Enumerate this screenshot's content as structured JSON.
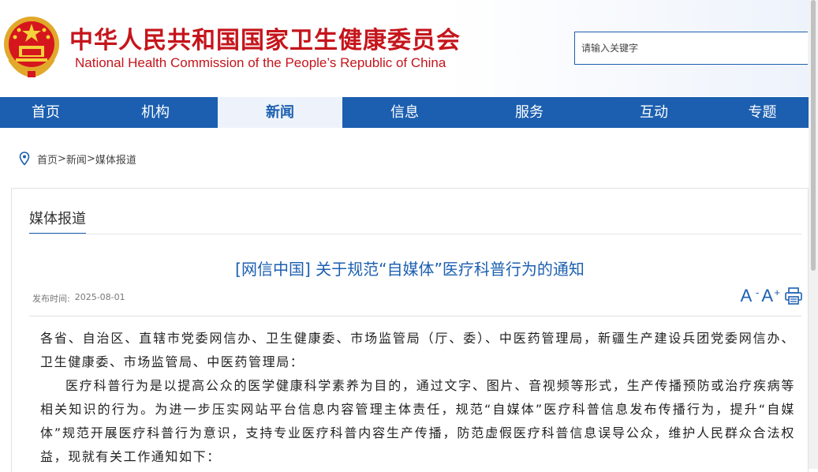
{
  "header": {
    "title_cn": "中华人民共和国国家卫生健康委员会",
    "title_en": "National Health Commission of the People’s  Republic of China",
    "emblem_icon": "national-emblem-icon",
    "brand_color": "#c5151c"
  },
  "search": {
    "placeholder": "请输入关键字"
  },
  "nav": {
    "accent": "#1c5fb0",
    "items": [
      {
        "label": "首页"
      },
      {
        "label": "机构"
      },
      {
        "label": "新闻",
        "active": true
      },
      {
        "label": "信息"
      },
      {
        "label": "服务"
      },
      {
        "label": "互动"
      },
      {
        "label": "专题"
      }
    ]
  },
  "breadcrumb": {
    "icon": "location-pin-icon",
    "items": [
      "首页",
      "新闻",
      "媒体报道"
    ],
    "separator": ">"
  },
  "section": {
    "title": "媒体报道"
  },
  "article": {
    "title": "[网信中国] 关于规范“自媒体”医疗科普行为的通知",
    "date_label": "发布时间:",
    "date": "2025-08-01",
    "font_decrease_label": "A",
    "font_increase_label": "A",
    "print_icon": "print-icon",
    "paragraphs": [
      "各省、自治区、直辖市党委网信办、卫生健康委、市场监管局（厅、委）、中医药管理局，新疆生产建设兵团党委网信办、卫生健康委、市场监管局、中医药管理局：",
      "医疗科普行为是以提高公众的医学健康科学素养为目的，通过文字、图片、音视频等形式，生产传播预防或治疗疾病等相关知识的行为。为进一步压实网站平台信息内容管理主体责任，规范“自媒体”医疗科普信息发布传播行为，提升“自媒体”规范开展医疗科普行为意识，支持专业医疗科普内容生产传播，防范虚假医疗科普信息误导公众，维护人民群众合法权益，现就有关工作通知如下："
    ]
  }
}
